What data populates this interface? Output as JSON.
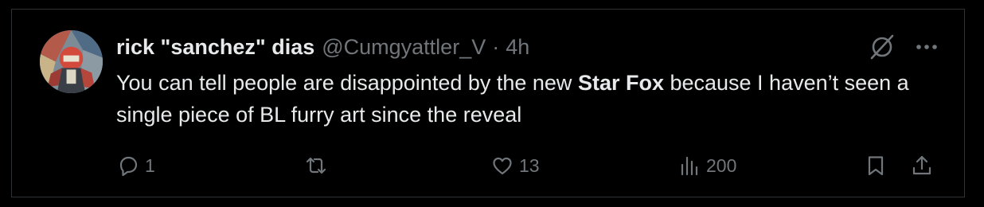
{
  "post": {
    "author": {
      "display_name": "rick \"sanchez\" dias",
      "handle": "@Cumgyattler_V",
      "separator": "·",
      "time": "4h",
      "avatar_icon": "avatar-image"
    },
    "text": {
      "part1": "You can tell people are disappointed by the new ",
      "bold": "Star Fox",
      "part2": " because I haven’t seen a single piece of BL furry art since the reveal"
    },
    "metrics": {
      "replies": "1",
      "reposts": "",
      "likes": "13",
      "views": "200"
    },
    "icons": {
      "grok": "grok-icon",
      "more": "more-icon",
      "reply": "reply-icon",
      "repost": "repost-icon",
      "like": "heart-icon",
      "views": "analytics-icon",
      "bookmark": "bookmark-icon",
      "share": "share-icon"
    },
    "colors": {
      "background": "#000000",
      "primary_text": "#e7e9ea",
      "secondary_text": "#71767b",
      "border": "#2f3336"
    }
  }
}
